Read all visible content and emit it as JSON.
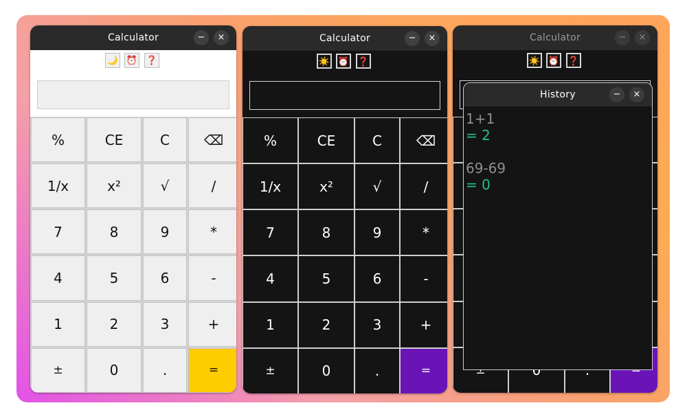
{
  "colors": {
    "light_equals": "#ffcc00",
    "dark_equals": "#6a14b8",
    "history_result": "#22c08a",
    "history_expr": "#8f8f8f"
  },
  "windows": {
    "light": {
      "title": "Calculator",
      "minimize_label": "−",
      "close_label": "×",
      "tools": [
        {
          "icon": "moon-icon",
          "glyph": "🌙"
        },
        {
          "icon": "alarm-clock-icon",
          "glyph": "⏰"
        },
        {
          "icon": "question-icon",
          "glyph": "❓"
        }
      ],
      "display_value": ""
    },
    "dark": {
      "title": "Calculator",
      "minimize_label": "−",
      "close_label": "×",
      "tools": [
        {
          "icon": "sun-icon",
          "glyph": "☀️"
        },
        {
          "icon": "alarm-clock-icon",
          "glyph": "⏰"
        },
        {
          "icon": "question-icon",
          "glyph": "❓"
        }
      ],
      "display_value": ""
    },
    "third": {
      "title": "Calculator",
      "minimize_label": "−",
      "close_label": "×",
      "tools": [
        {
          "icon": "sun-icon",
          "glyph": "☀️"
        },
        {
          "icon": "alarm-clock-icon",
          "glyph": "⏰"
        },
        {
          "icon": "question-icon",
          "glyph": "❓"
        }
      ],
      "bottom_keys": [
        "±",
        "0",
        ".",
        "="
      ]
    }
  },
  "keypad": [
    "%",
    "CE",
    "C",
    "⌫",
    "1/x",
    "x²",
    "√",
    "/",
    "7",
    "8",
    "9",
    "*",
    "4",
    "5",
    "6",
    "-",
    "1",
    "2",
    "3",
    "+",
    "±",
    "0",
    ".",
    "="
  ],
  "history": {
    "title": "History",
    "minimize_label": "−",
    "close_label": "×",
    "entries": [
      {
        "expr": "1+1",
        "result": "= 2"
      },
      {
        "expr": "69-69",
        "result": "= 0"
      }
    ]
  }
}
